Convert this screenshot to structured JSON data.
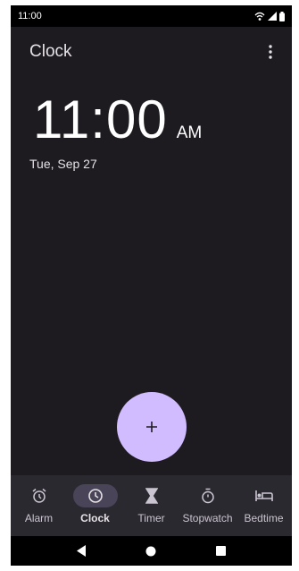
{
  "status_bar": {
    "time": "11:00"
  },
  "app_bar": {
    "title": "Clock"
  },
  "clock": {
    "time": "11:00",
    "ampm": "AM",
    "date": "Tue, Sep 27"
  },
  "fab": {
    "icon": "plus-icon"
  },
  "bottom_nav": {
    "items": [
      {
        "label": "Alarm",
        "icon": "alarm-icon",
        "active": false
      },
      {
        "label": "Clock",
        "icon": "clock-icon",
        "active": true
      },
      {
        "label": "Timer",
        "icon": "hourglass-icon",
        "active": false
      },
      {
        "label": "Stopwatch",
        "icon": "stopwatch-icon",
        "active": false
      },
      {
        "label": "Bedtime",
        "icon": "bed-icon",
        "active": false
      }
    ]
  },
  "colors": {
    "background": "#1d1b20",
    "fab": "#d0bcff",
    "nav_background": "#2b2930",
    "active_indicator": "#4a4458"
  }
}
